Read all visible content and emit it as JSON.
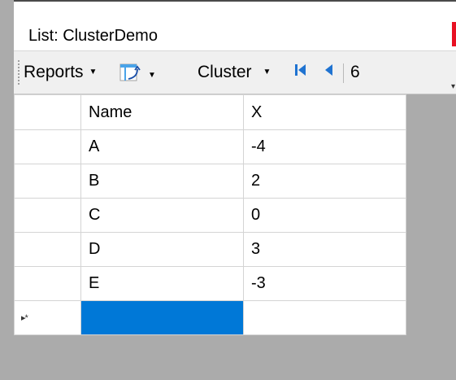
{
  "window": {
    "title": "List: ClusterDemo",
    "close_glyph": "×",
    "close_color": "#e81123"
  },
  "toolbar": {
    "reports_label": "Reports",
    "cluster_label": "Cluster",
    "page_number": "6",
    "transform_icon": "transform-icon",
    "first_icon": "first-record-icon",
    "prev_icon": "previous-record-icon"
  },
  "grid": {
    "columns": [
      "Name",
      "X"
    ],
    "rows": [
      {
        "name": "A",
        "x": "-4"
      },
      {
        "name": "B",
        "x": "2"
      },
      {
        "name": "C",
        "x": "0"
      },
      {
        "name": "D",
        "x": "3"
      },
      {
        "name": "E",
        "x": "-3"
      }
    ],
    "new_row_indicator": "▸*",
    "selection_color": "#0078d7"
  }
}
